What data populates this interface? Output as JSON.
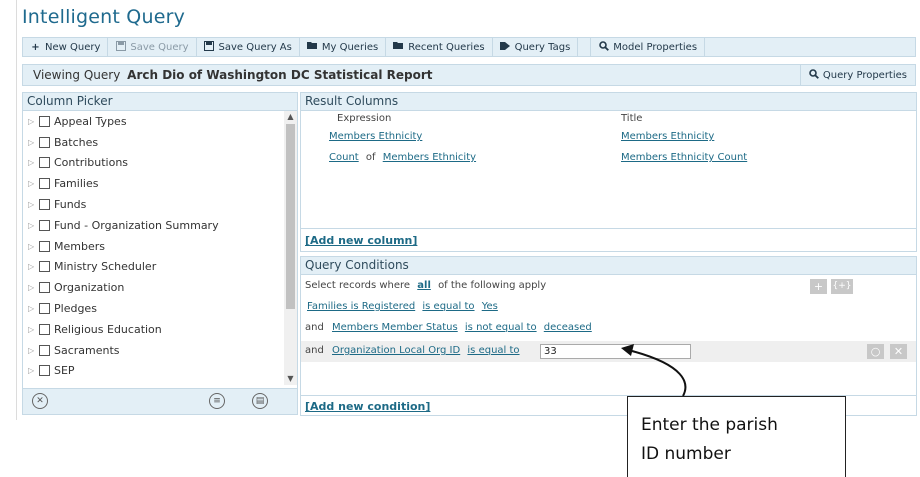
{
  "app_title": "Intelligent Query",
  "toolbar": {
    "new_query": "New Query",
    "save_query": "Save Query",
    "save_query_as": "Save Query As",
    "my_queries": "My Queries",
    "recent_queries": "Recent Queries",
    "query_tags": "Query Tags",
    "model_properties": "Model Properties"
  },
  "viewing": {
    "prefix": "Viewing Query",
    "query_name": "Arch Dio of Washington DC Statistical Report",
    "query_properties": "Query Properties"
  },
  "column_picker": {
    "title": "Column Picker",
    "items": [
      "Appeal Types",
      "Batches",
      "Contributions",
      "Families",
      "Funds",
      "Fund - Organization Summary",
      "Members",
      "Ministry Scheduler",
      "Organization",
      "Pledges",
      "Religious Education",
      "Sacraments",
      "SEP"
    ]
  },
  "result_columns": {
    "title": "Result Columns",
    "header_expression": "Expression",
    "header_title": "Title",
    "row1": {
      "expression": "Members Ethnicity",
      "title": "Members Ethnicity"
    },
    "row2": {
      "func": "Count",
      "of": "of",
      "expression": "Members Ethnicity",
      "title": "Members Ethnicity Count"
    },
    "add_column": "[Add new column]"
  },
  "query_conditions": {
    "title": "Query Conditions",
    "intro_prefix": "Select records where",
    "intro_all": "all",
    "intro_suffix": "of the following apply",
    "cond1": {
      "field": "Families is Registered",
      "op": "is equal to",
      "value": "Yes"
    },
    "cond2": {
      "joiner": "and",
      "field": "Members Member Status",
      "op": "is not equal to",
      "value": "deceased"
    },
    "cond3": {
      "joiner": "and",
      "field": "Organization Local Org ID",
      "op": "is equal to",
      "value": "33"
    },
    "add_condition": "[Add new condition]"
  },
  "callout": {
    "line1": "Enter the parish",
    "line2": "ID number"
  },
  "colors": {
    "accent": "#1d6a86",
    "bar": "#e3eff6",
    "border": "#c6d9e5"
  }
}
